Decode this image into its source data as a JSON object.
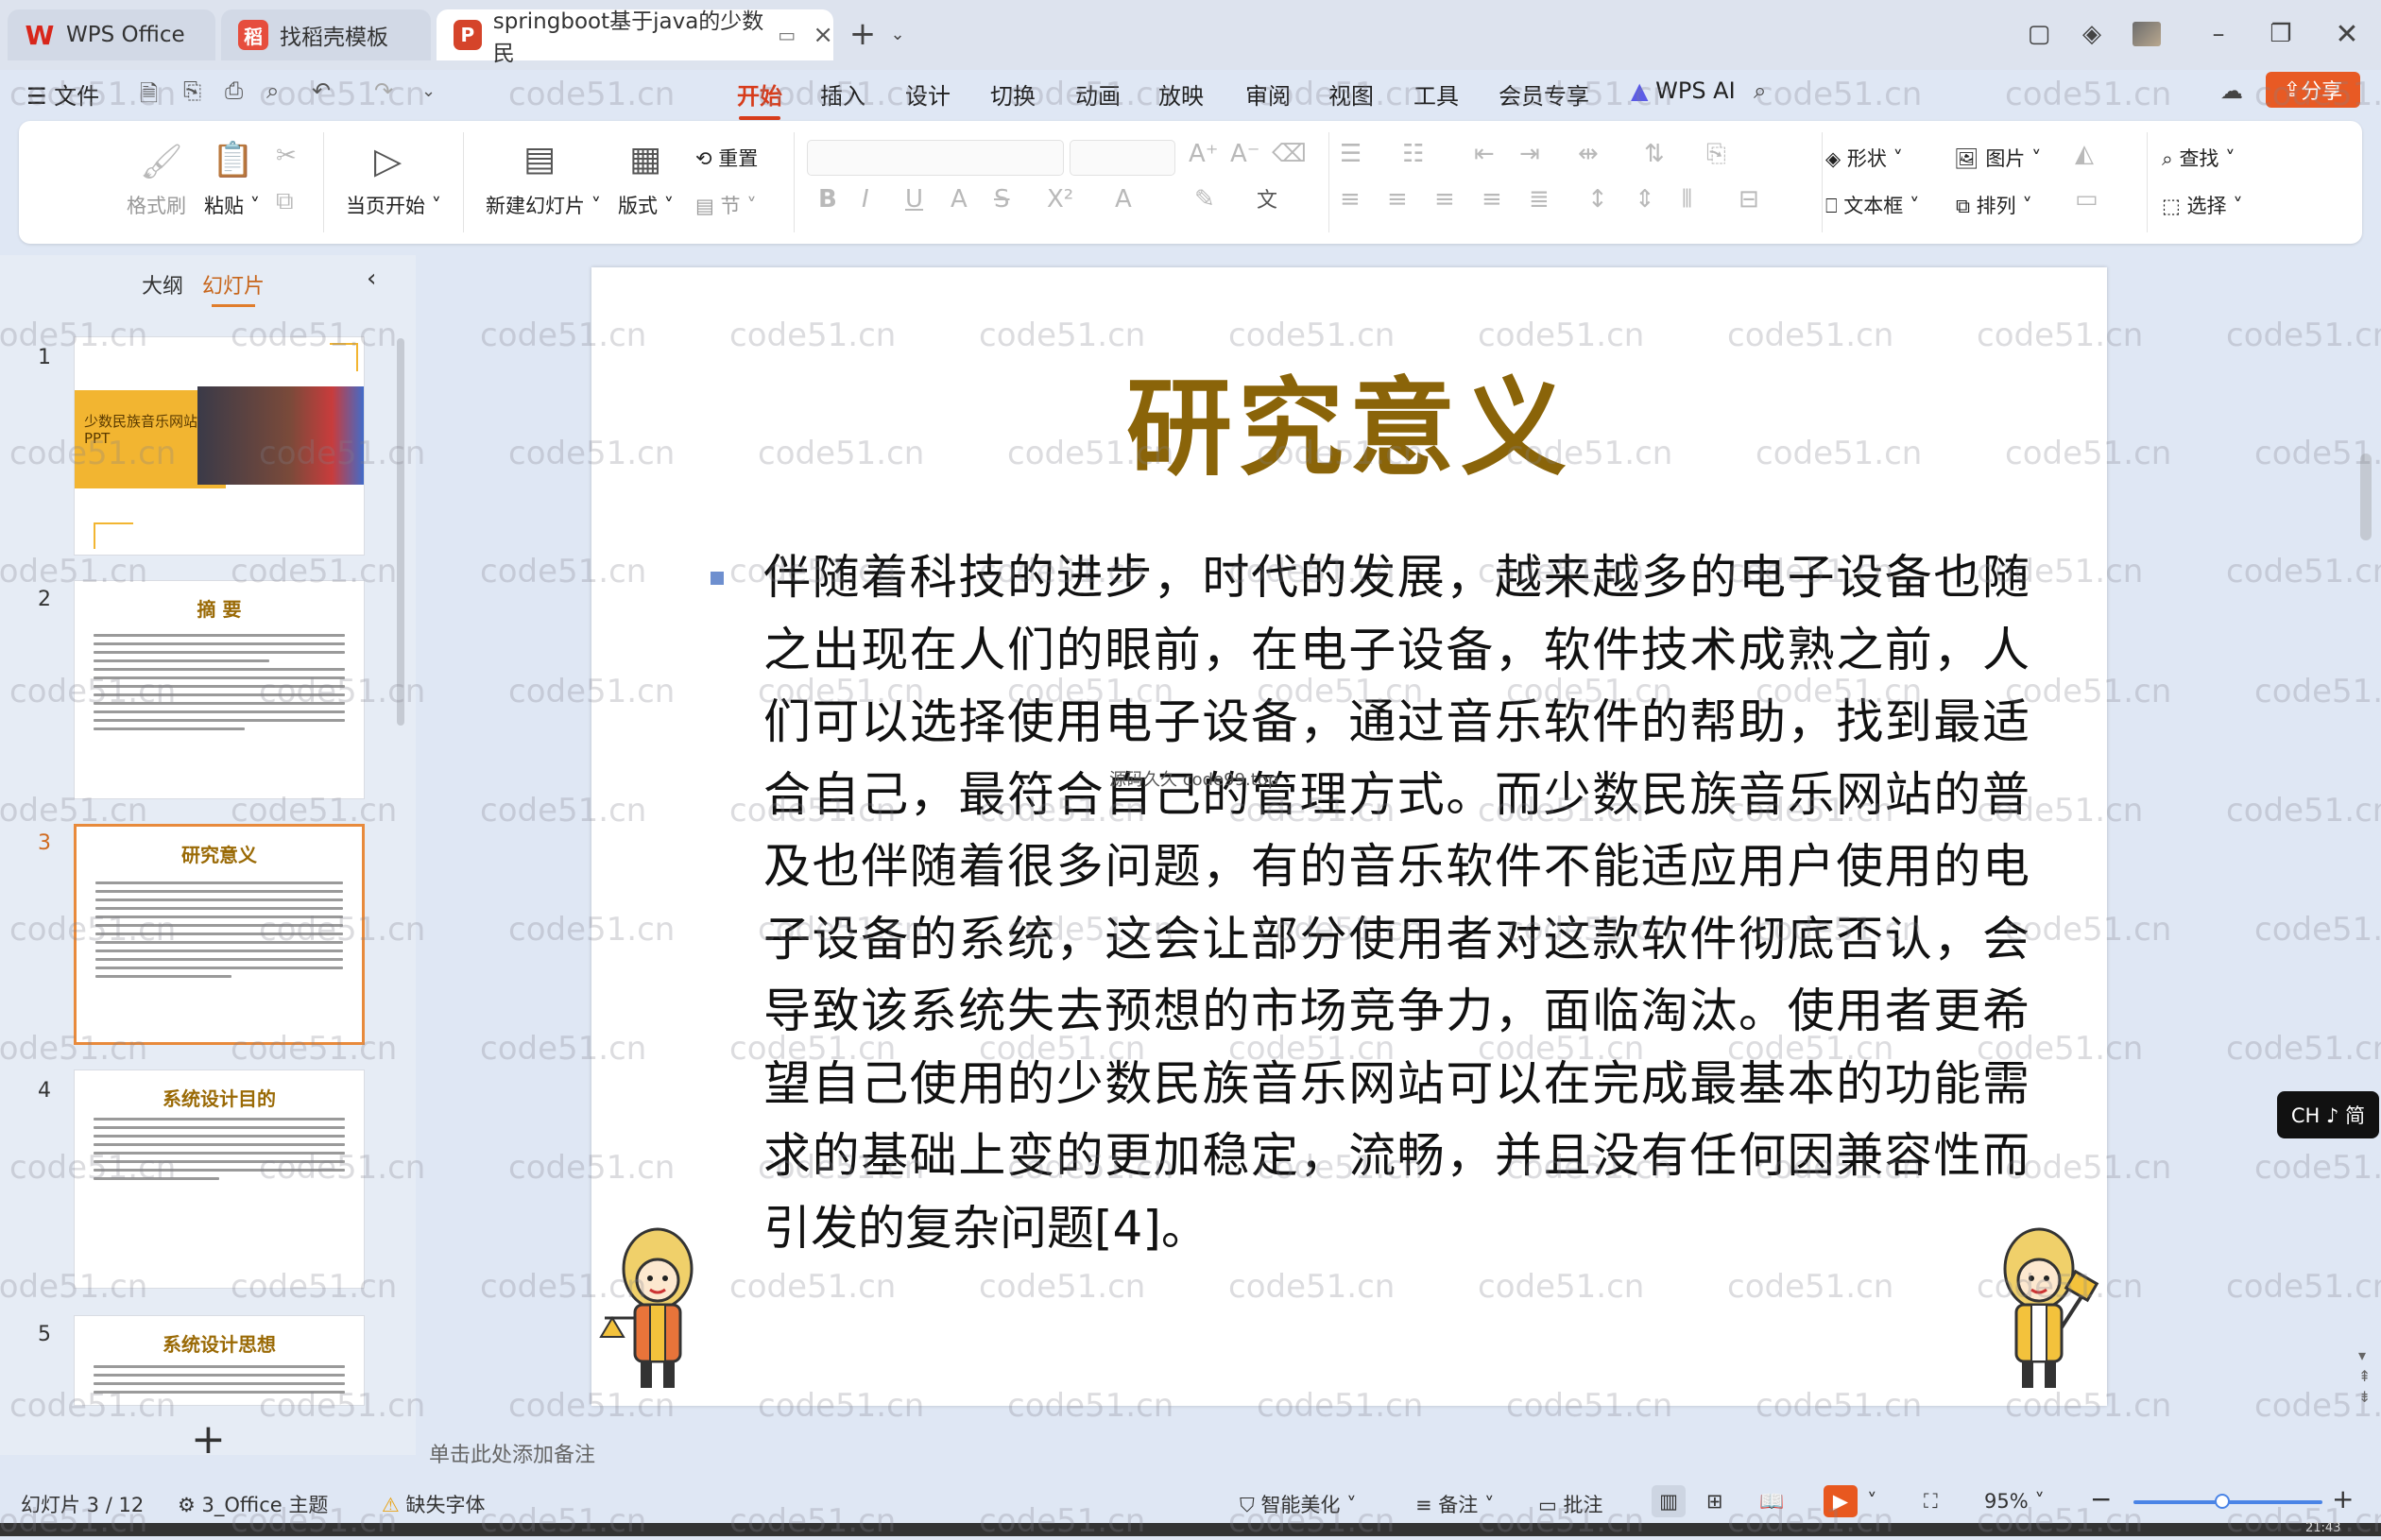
{
  "titlebar": {
    "tabs": [
      {
        "label": "WPS Office",
        "icon": "wps-logo-icon"
      },
      {
        "label": "找稻壳模板",
        "icon": "docer-icon"
      },
      {
        "label": "springboot基于java的少数民",
        "icon": "ppt-file-icon"
      }
    ],
    "new_tab": "+"
  },
  "menubar": {
    "file_label": "文件",
    "tabs": [
      "开始",
      "插入",
      "设计",
      "切换",
      "动画",
      "放映",
      "审阅",
      "视图",
      "工具",
      "会员专享"
    ],
    "active_tab": "开始",
    "ai_label": "WPS AI",
    "share_label": "分享",
    "share_color": "#e85a24"
  },
  "ribbon": {
    "format_painter": "格式刷",
    "paste": "粘贴",
    "from_current": "当页开始",
    "new_slide": "新建幻灯片",
    "layout": "版式",
    "reset": "重置",
    "section": "节",
    "shape": "形状",
    "picture": "图片",
    "textbox": "文本框",
    "arrange": "排列",
    "find": "查找",
    "select": "选择"
  },
  "sidebar": {
    "tab_outline": "大纲",
    "tab_slides": "幻灯片",
    "thumbnails": [
      {
        "num": "1",
        "title": "少数民族音乐网站 PPT"
      },
      {
        "num": "2",
        "title": "摘 要"
      },
      {
        "num": "3",
        "title": "研究意义"
      },
      {
        "num": "4",
        "title": "系统设计目的"
      },
      {
        "num": "5",
        "title": "系统设计思想"
      }
    ],
    "add": "+"
  },
  "slide": {
    "title": "研究意义",
    "body": "伴随着科技的进步，时代的发展，越来越多的电子设备也随之出现在人们的眼前，在电子设备，软件技术成熟之前，人们可以选择使用电子设备，通过音乐软件的帮助，找到最适合自己，最符合自己的管理方式。而少数民族音乐网站的普及也伴随着很多问题，有的音乐软件不能适应用户使用的电子设备的系统，这会让部分使用者对这款软件彻底否认，会导致该系统失去预想的市场竞争力，面临淘汰。使用者更希望自己使用的少数民族音乐网站可以在完成最基本的功能需求的基础上变的更加稳定，流畅，并且没有任何因兼容性而引发的复杂问题[4]。",
    "overlay_text": "源码久久 code99.top",
    "title_color": "#8a6409"
  },
  "notes": {
    "placeholder": "单击此处添加备注"
  },
  "statusbar": {
    "slide_count": "幻灯片 3 / 12",
    "theme": "3_Office 主题",
    "missing_font": "缺失字体",
    "smart_beautify": "智能美化",
    "notes": "备注",
    "comments": "批注",
    "zoom": "95%"
  },
  "ime_hint": "CH ♪ 简",
  "clock": "21:43",
  "watermark": "code51.cn"
}
